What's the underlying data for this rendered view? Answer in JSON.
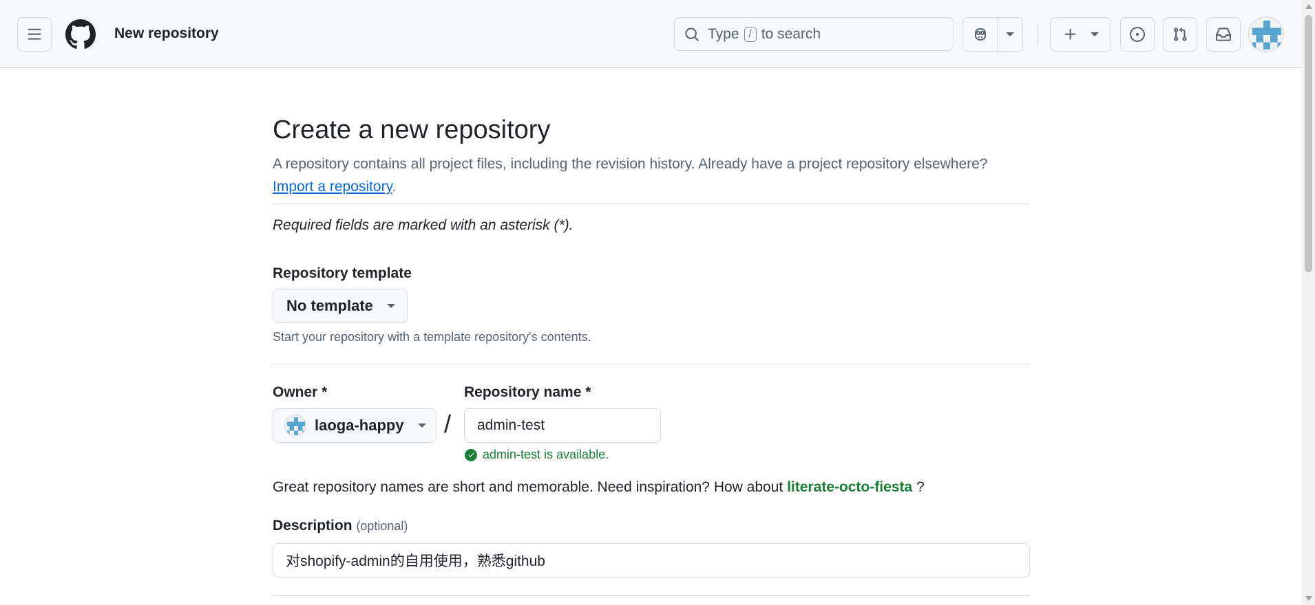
{
  "header": {
    "page_context": "New repository",
    "search": {
      "prefix": "Type",
      "key": "/",
      "suffix": "to search"
    }
  },
  "main": {
    "title": "Create a new repository",
    "lead_text": "A repository contains all project files, including the revision history. Already have a project repository elsewhere?",
    "import_link": "Import a repository",
    "lead_period": ".",
    "required_note": "Required fields are marked with an asterisk (*).",
    "template": {
      "label": "Repository template",
      "selected": "No template",
      "hint": "Start your repository with a template repository's contents."
    },
    "owner": {
      "label": "Owner *",
      "selected": "laoga-happy"
    },
    "slash": "/",
    "repo_name": {
      "label": "Repository name *",
      "value": "admin-test",
      "availability": "admin-test is available."
    },
    "suggestion": {
      "prefix": "Great repository names are short and memorable. Need inspiration? How about",
      "name": "literate-octo-fiesta",
      "suffix": "?"
    },
    "description": {
      "label": "Description",
      "optional": "(optional)",
      "value": "对shopify-admin的自用使用，熟悉github"
    }
  },
  "icons": [
    "menu-icon",
    "github-logo-icon",
    "search-icon",
    "copilot-icon",
    "plus-icon",
    "issue-icon",
    "pull-request-icon",
    "inbox-icon",
    "check-circle-icon"
  ],
  "colors": {
    "header_bg": "#f6f8fa",
    "border": "#d1d9e0",
    "link": "#0969da",
    "success": "#1a7f37",
    "text": "#1f2328",
    "muted": "#59636e"
  }
}
